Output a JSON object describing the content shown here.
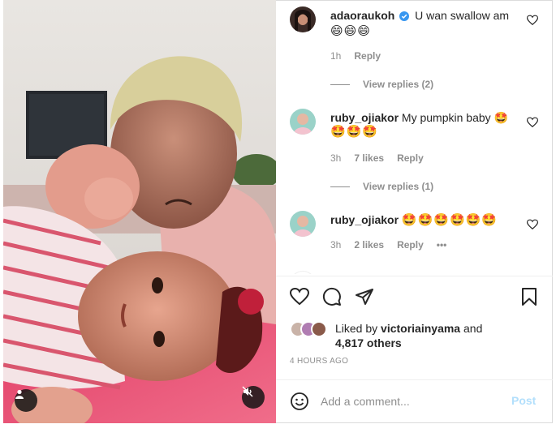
{
  "comments": [
    {
      "username": "adaoraukoh",
      "verified": true,
      "text": "U wan swallow am",
      "emoji_line": "😄😄😄",
      "time": "1h",
      "likes": "",
      "reply_label": "Reply",
      "view_replies": "View replies (2)"
    },
    {
      "username": "ruby_ojiakor",
      "verified": false,
      "text": "My pumpkin baby 🤩",
      "emoji_line": "🤩🤩🤩",
      "time": "3h",
      "likes": "7 likes",
      "reply_label": "Reply",
      "view_replies": "View replies (1)"
    },
    {
      "username": "ruby_ojiakor",
      "verified": false,
      "text": "🤩🤩🤩🤩🤩🤩",
      "emoji_line": "",
      "time": "3h",
      "likes": "2 likes",
      "reply_label": "Reply",
      "more": "•••"
    }
  ],
  "liked_by": {
    "prefix": "Liked by",
    "user": "victoriainyama",
    "and": "and",
    "others": "4,817 others"
  },
  "time_ago": "4 HOURS AGO",
  "add_comment": {
    "placeholder": "Add a comment...",
    "post_label": "Post"
  },
  "icons": {
    "like": "heart-icon",
    "comment": "comment-bubble-icon",
    "share": "paper-plane-icon",
    "save": "bookmark-icon",
    "emoji": "smiley-icon",
    "user_tag": "user-icon",
    "mute": "muted-speaker-icon"
  },
  "colors": {
    "verified": "#3897f0",
    "post_disabled": "#b2dffc",
    "secondary_text": "#8e8e8e"
  }
}
